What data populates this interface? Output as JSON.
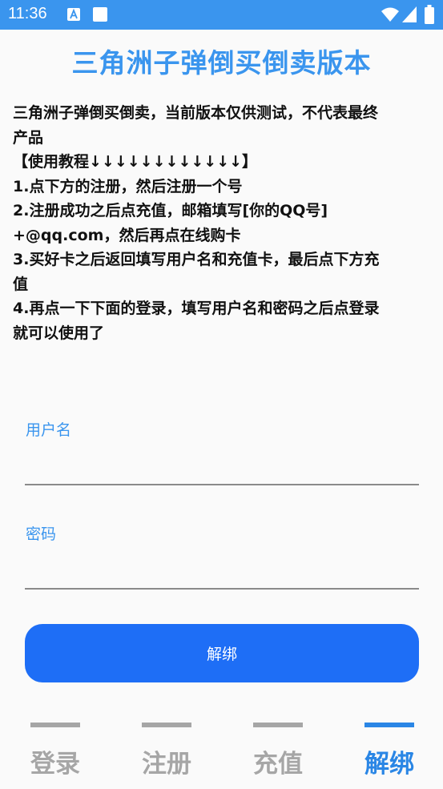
{
  "status_bar": {
    "time": "11:36",
    "icons": [
      "a-notification-icon",
      "square-notification-icon",
      "wifi-icon",
      "signal-icon",
      "battery-icon"
    ],
    "color": "#3a95ee"
  },
  "app": {
    "title": "三角洲子弹倒买倒卖版本"
  },
  "instructions": {
    "lines": [
      "三角洲子弹倒买倒卖，当前版本仅供测试，不代表最终",
      "产品",
      "【使用教程↓↓↓↓↓↓↓↓↓↓↓↓】",
      "1.点下方的注册，然后注册一个号",
      "2.注册成功之后点充值，邮箱填写[你的QQ号]",
      "+@qq.com，然后再点在线购卡",
      "3.买好卡之后返回填写用户名和充值卡，最后点下方充",
      "值",
      "4.再点一下下面的登录，填写用户名和密码之后点登录",
      "就可以使用了"
    ]
  },
  "form": {
    "username_label": "用户名",
    "username_value": "",
    "password_label": "密码",
    "password_value": "",
    "submit_label": "解绑"
  },
  "bottom_nav": {
    "items": [
      {
        "label": "登录",
        "active": false
      },
      {
        "label": "注册",
        "active": false
      },
      {
        "label": "充值",
        "active": false
      },
      {
        "label": "解绑",
        "active": true
      }
    ],
    "active_color": "#2a86e5",
    "inactive_color": "#a6a6a6"
  },
  "colors": {
    "accent": "#3a95ee",
    "button": "#1e6ef6"
  }
}
